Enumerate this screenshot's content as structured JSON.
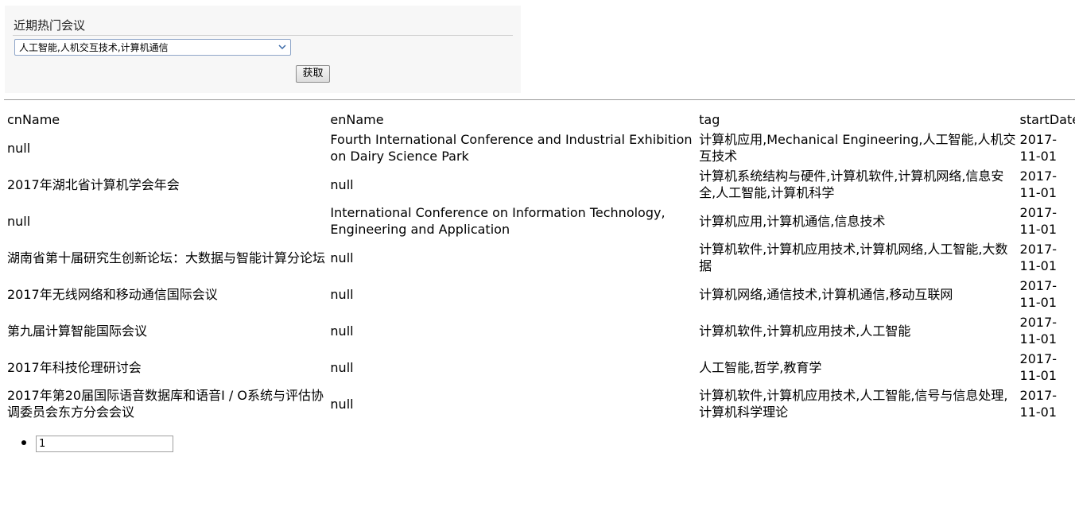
{
  "panel": {
    "title": "近期热门会议",
    "select_value": "人工智能,人机交互技术,计算机通信",
    "fetch_label": "获取"
  },
  "table": {
    "headers": [
      "cnName",
      "enName",
      "tag",
      "startDate"
    ],
    "rows": [
      [
        "null",
        "Fourth International Conference and Industrial Exhibition on Dairy Science Park",
        "计算机应用,Mechanical Engineering,人工智能,人机交互技术",
        "2017-11-01"
      ],
      [
        "2017年湖北省计算机学会年会",
        "null",
        "计算机系统结构与硬件,计算机软件,计算机网络,信息安全,人工智能,计算机科学",
        "2017-11-01"
      ],
      [
        "null",
        "International Conference on Information Technology, Engineering and Application",
        "计算机应用,计算机通信,信息技术",
        "2017-11-01"
      ],
      [
        "湖南省第十届研究生创新论坛：大数据与智能计算分论坛",
        "null",
        "计算机软件,计算机应用技术,计算机网络,人工智能,大数据",
        "2017-11-01"
      ],
      [
        "2017年无线网络和移动通信国际会议",
        "null",
        "计算机网络,通信技术,计算机通信,移动互联网",
        "2017-11-01"
      ],
      [
        "第九届计算智能国际会议",
        "null",
        "计算机软件,计算机应用技术,人工智能",
        "2017-11-01"
      ],
      [
        "2017年科技伦理研讨会",
        "null",
        "人工智能,哲学,教育学",
        "2017-11-01"
      ],
      [
        "2017年第20届国际语音数据库和语音I / O系统与评估协调委员会东方分会会议",
        "null",
        "计算机软件,计算机应用技术,人工智能,信号与信息处理,计算机科学理论",
        "2017-11-01"
      ]
    ]
  },
  "pager": {
    "page_value": "1"
  }
}
